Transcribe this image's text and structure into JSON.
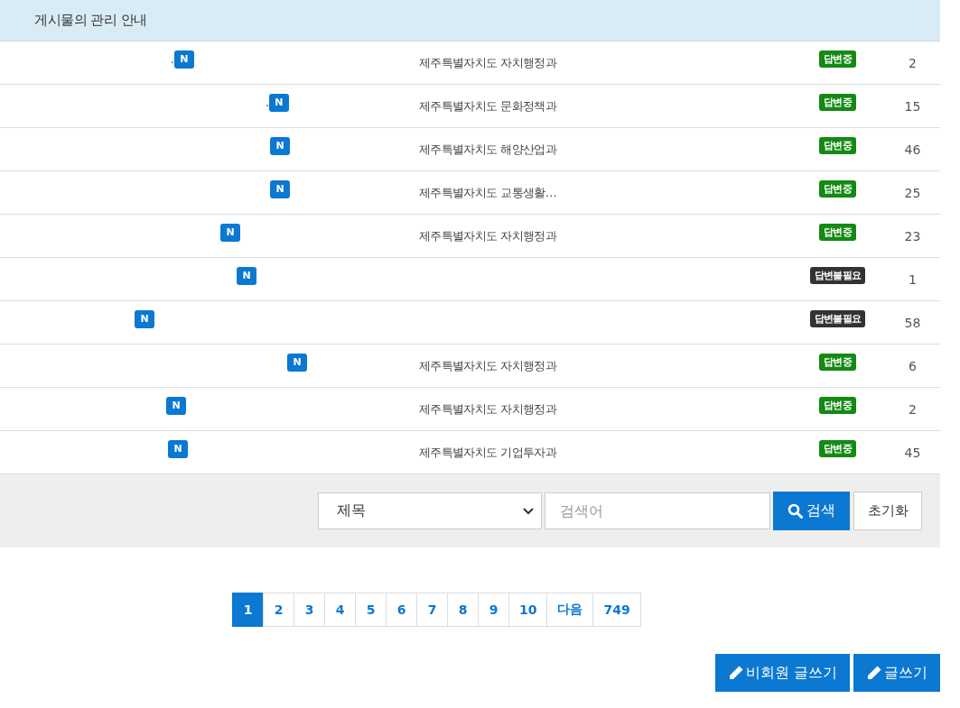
{
  "header": {
    "title": "게시물의 관리 안내"
  },
  "rows": [
    {
      "title": ".",
      "new_badge": "N",
      "department": "제주특별자치도 자치행정과",
      "status": {
        "kind": "answering",
        "label": "답변중"
      },
      "count": "2"
    },
    {
      "title": ".",
      "new_badge": "N",
      "department": "제주특별자치도 문화정책과",
      "status": {
        "kind": "answering",
        "label": "답변중"
      },
      "count": "15"
    },
    {
      "new_badge": "N",
      "department": "제주특별자치도 해양산업과",
      "status": {
        "kind": "answering",
        "label": "답변중"
      },
      "count": "46"
    },
    {
      "new_badge": "N",
      "department": "제주특별자치도 교통생활…",
      "status": {
        "kind": "answering",
        "label": "답변중"
      },
      "count": "25"
    },
    {
      "new_badge": "N",
      "department": "제주특별자치도 자치행정과",
      "status": {
        "kind": "answering",
        "label": "답변중"
      },
      "count": "23"
    },
    {
      "new_badge": "N",
      "status": {
        "kind": "not_needed",
        "label": "답변불필요"
      },
      "count": "1"
    },
    {
      "new_badge": "N",
      "status": {
        "kind": "not_needed",
        "label": "답변불필요"
      },
      "count": "58"
    },
    {
      "new_badge": "N",
      "department": "제주특별자치도 자치행정과",
      "status": {
        "kind": "answering",
        "label": "답변중"
      },
      "count": "6"
    },
    {
      "new_badge": "N",
      "department": "제주특별자치도 자치행정과",
      "status": {
        "kind": "answering",
        "label": "답변중"
      },
      "count": "2"
    },
    {
      "new_badge": "N",
      "department": "제주특별자치도 기업투자과",
      "status": {
        "kind": "answering",
        "label": "답변중"
      },
      "count": "45"
    }
  ],
  "search": {
    "select_value": "제목",
    "placeholder": "검색어",
    "search_button": "검색",
    "reset_button": "초기화"
  },
  "pagination": [
    {
      "label": "1",
      "selected": true
    },
    {
      "label": "2",
      "selected": false
    },
    {
      "label": "3",
      "selected": false
    },
    {
      "label": "4",
      "selected": false
    },
    {
      "label": "5",
      "selected": false
    },
    {
      "label": "6",
      "selected": false
    },
    {
      "label": "7",
      "selected": false
    },
    {
      "label": "8",
      "selected": false
    },
    {
      "label": "9",
      "selected": false
    },
    {
      "label": "10",
      "selected": false
    },
    {
      "label": "다음",
      "selected": false
    },
    {
      "label": "749",
      "selected": false
    }
  ],
  "actions": {
    "guest_write": "비회원 글쓰기",
    "write": "글쓰기"
  }
}
